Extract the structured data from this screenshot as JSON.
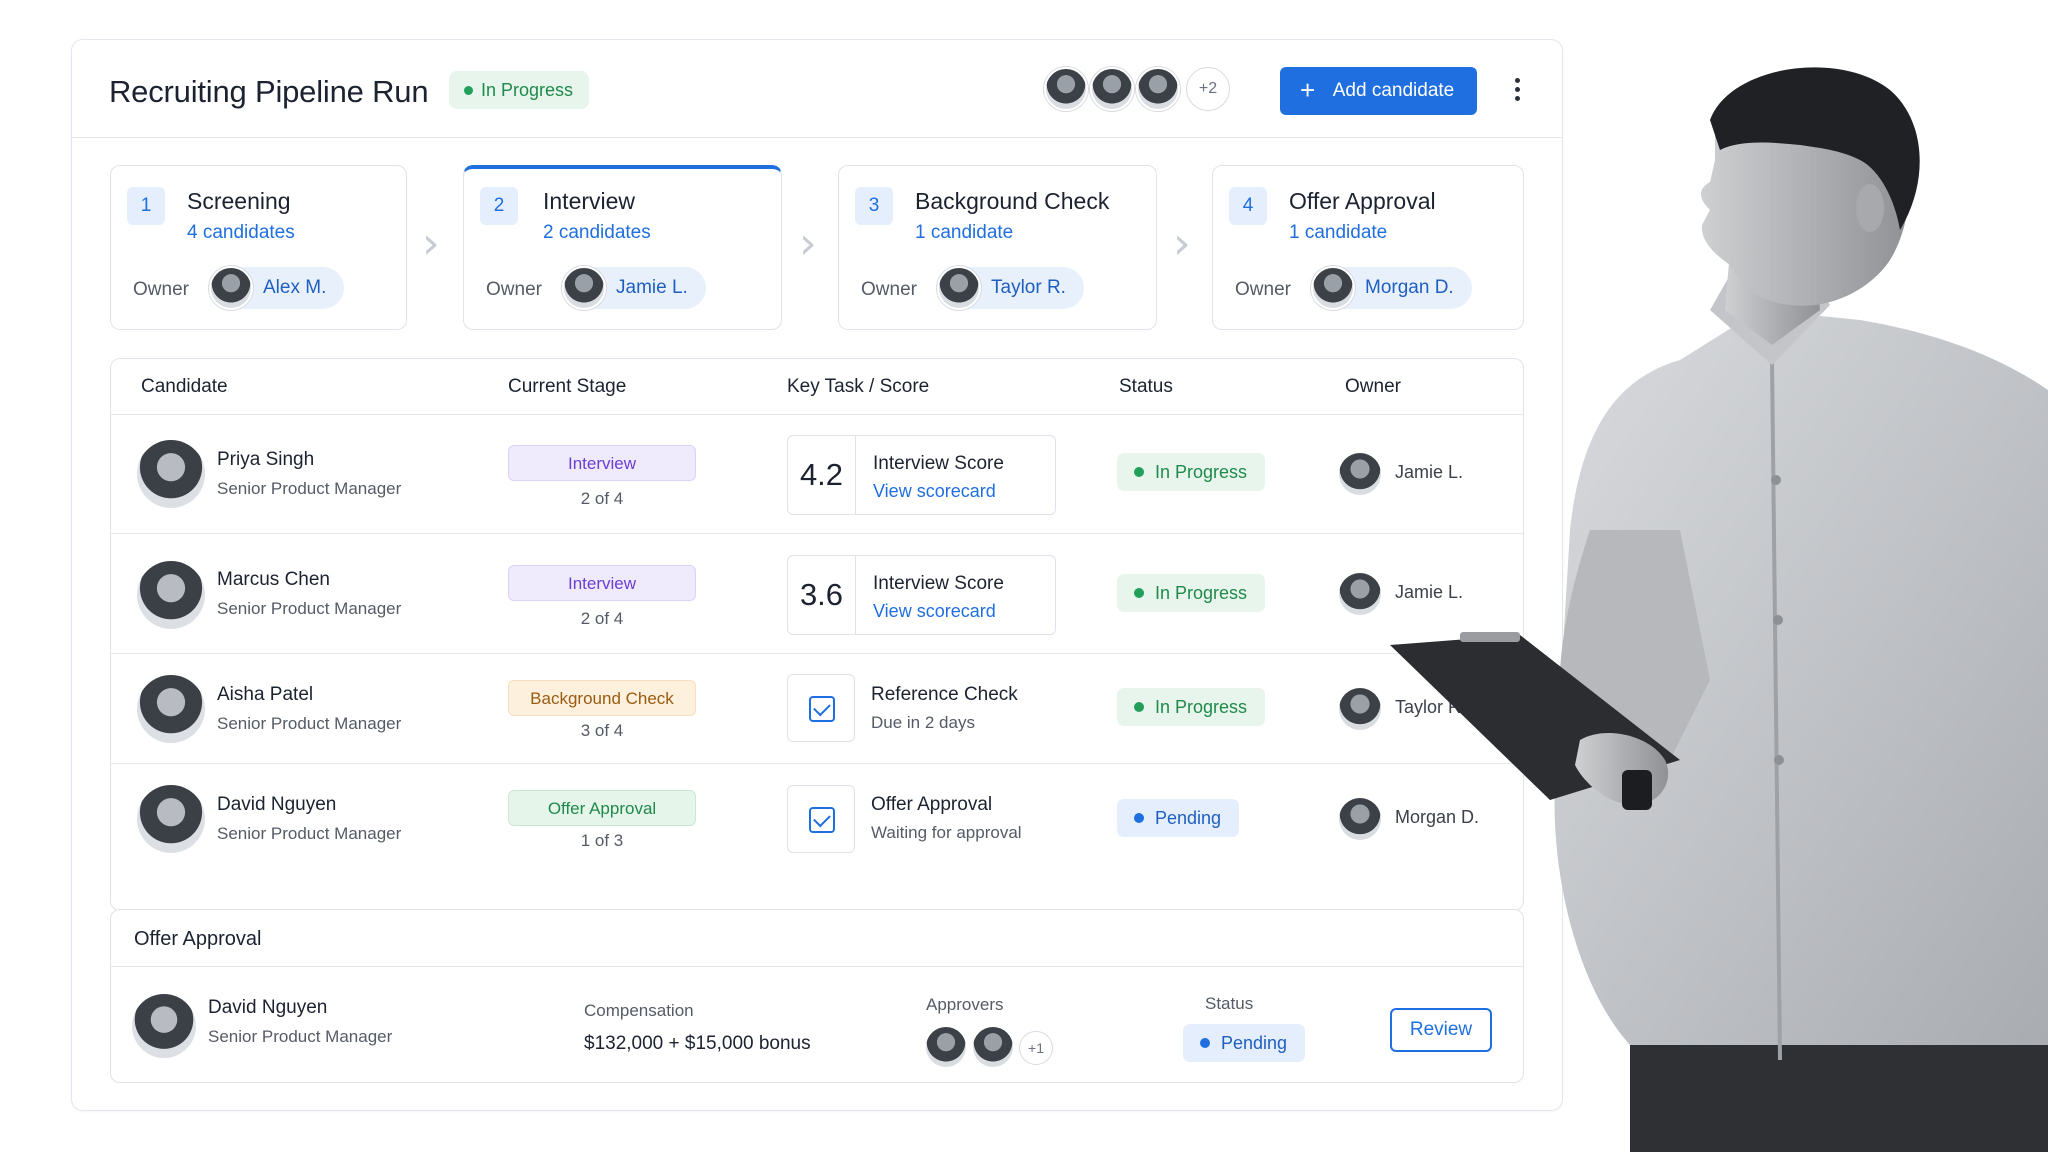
{
  "header": {
    "title": "Recruiting Pipeline Run",
    "status": "In Progress",
    "more_avatars": "+2",
    "add_button": "Add candidate"
  },
  "stages": [
    {
      "num": "1",
      "name": "Screening",
      "count": "4 candidates",
      "owner_label": "Owner",
      "owner": "Alex M."
    },
    {
      "num": "2",
      "name": "Interview",
      "count": "2 candidates",
      "owner_label": "Owner",
      "owner": "Jamie L."
    },
    {
      "num": "3",
      "name": "Background Check",
      "count": "1 candidate",
      "owner_label": "Owner",
      "owner": "Taylor R."
    },
    {
      "num": "4",
      "name": "Offer Approval",
      "count": "1 candidate",
      "owner_label": "Owner",
      "owner": "Morgan D."
    }
  ],
  "table": {
    "columns": [
      "Candidate",
      "Current Stage",
      "Key Task / Score",
      "Status",
      "Owner"
    ],
    "rows": [
      {
        "name": "Priya Singh",
        "role": "Senior Product Manager",
        "stage": "Interview",
        "stage_progress": "2 of 4",
        "score": "4.2",
        "task": "Interview Score",
        "task_link": "View scorecard",
        "status": "In Progress",
        "owner": "Jamie L."
      },
      {
        "name": "Marcus Chen",
        "role": "Senior Product Manager",
        "stage": "Interview",
        "stage_progress": "2 of 4",
        "score": "3.6",
        "task": "Interview Score",
        "task_link": "View scorecard",
        "status": "In Progress",
        "owner": "Jamie L."
      },
      {
        "name": "Aisha Patel",
        "role": "Senior Product Manager",
        "stage": "Background Check",
        "stage_progress": "3 of 4",
        "task": "Reference Check",
        "task_sub": "Due in 2 days",
        "status": "In Progress",
        "owner": "Taylor R."
      },
      {
        "name": "David Nguyen",
        "role": "Senior Product Manager",
        "stage": "Offer Approval",
        "stage_progress": "1 of 3",
        "task": "Offer Approval",
        "task_sub": "Waiting for approval",
        "status": "Pending",
        "owner": "Morgan D."
      }
    ]
  },
  "offer_panel": {
    "title": "Offer Approval",
    "name": "David Nguyen",
    "role": "Senior Product Manager",
    "comp_label": "Compensation",
    "comp_value": "$132,000 + $15,000 bonus",
    "approvers_label": "Approvers",
    "approvers_more": "+1",
    "status_label": "Status",
    "status": "Pending",
    "review_button": "Review"
  },
  "colors": {
    "accent": "#1f6fe0",
    "success": "#22a05b",
    "interview": "#6b3fd4",
    "background_check": "#9a5b12"
  }
}
